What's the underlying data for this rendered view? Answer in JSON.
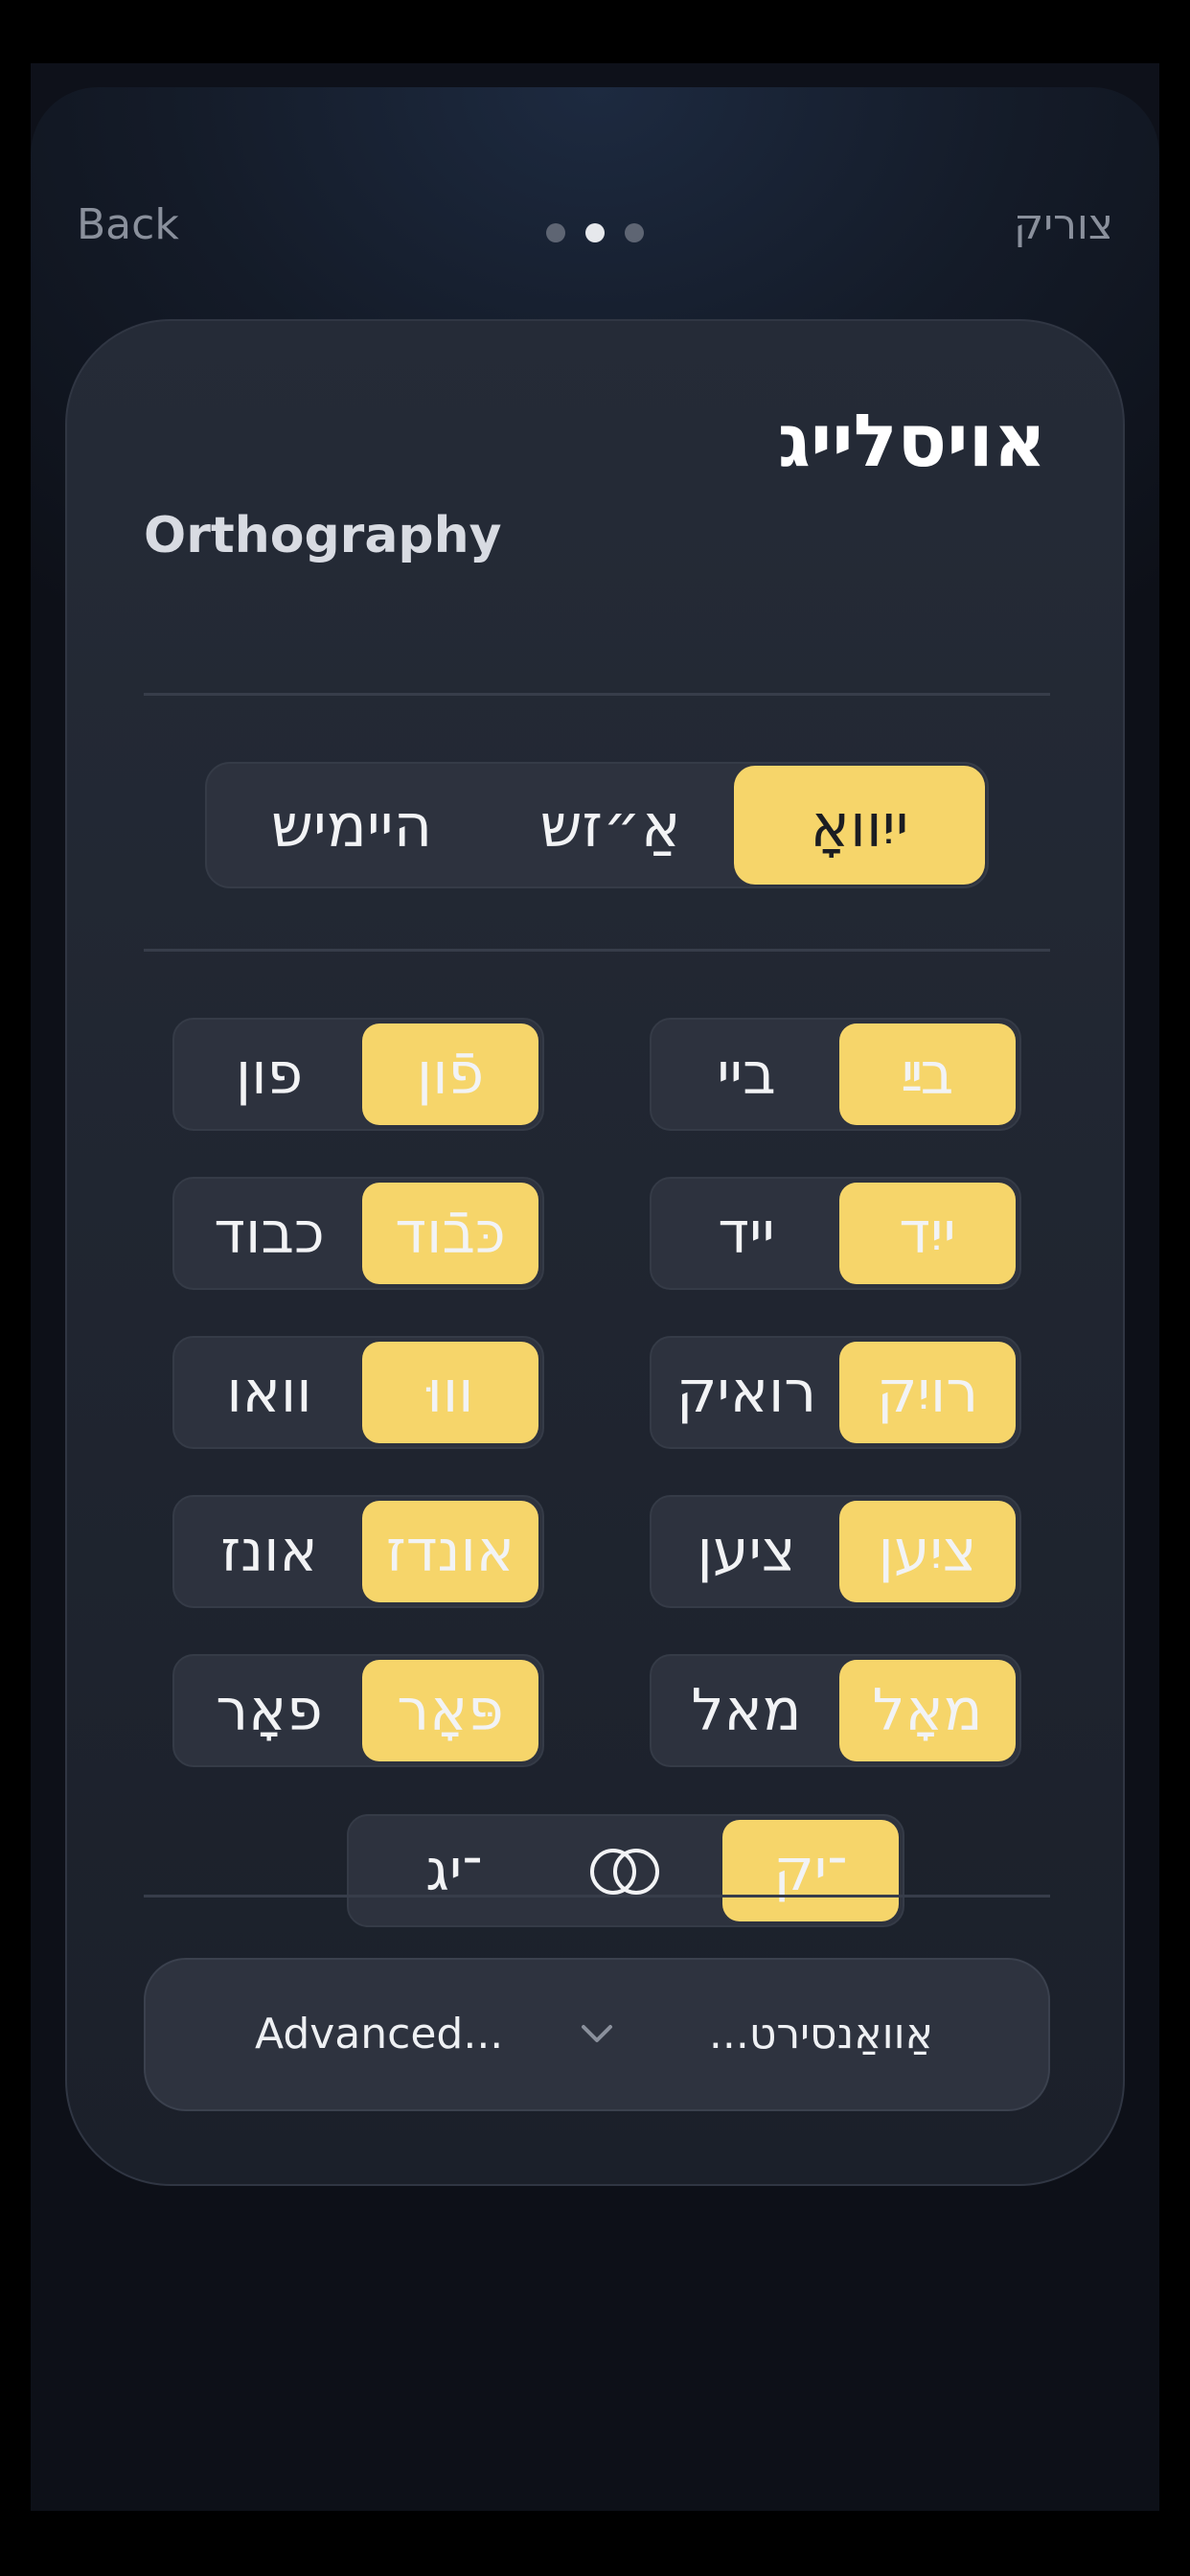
{
  "nav": {
    "back_label": "Back",
    "back_label_yiddish": "צוריק",
    "page_dots": 3,
    "active_page": 2
  },
  "card": {
    "title": "אויסלייג",
    "subtitle": "Orthography"
  },
  "system_selector": {
    "options": [
      "ייִוואָ",
      "אַ״זש",
      "היימיש"
    ],
    "selected": "ייִוואָ"
  },
  "pairs": [
    {
      "selected": "פֿון",
      "alternate": "פון"
    },
    {
      "selected": "בײַ",
      "alternate": "ביי"
    },
    {
      "selected": "כּבֿוד",
      "alternate": "כבוד"
    },
    {
      "selected": "ייִד",
      "alternate": "ייד"
    },
    {
      "selected": "וווּ",
      "alternate": "וואו"
    },
    {
      "selected": "רויִק",
      "alternate": "רואיק"
    },
    {
      "selected": "אונדז",
      "alternate": "אונז"
    },
    {
      "selected": "ציִען",
      "alternate": "ציען"
    },
    {
      "selected": "פּאָר",
      "alternate": "פאָר"
    },
    {
      "selected": "מאָל",
      "alternate": "מאל"
    }
  ],
  "ending": {
    "selected": "־יק",
    "alternate": "־יג",
    "link_icon": "linked-rings-icon"
  },
  "advanced": {
    "label": "Advanced...",
    "label_yiddish": "אַוואַנסירט...",
    "icon": "chevron-down-icon"
  },
  "colors": {
    "accent": "#f6d56a",
    "background": "#0e111a",
    "card": "#232834"
  }
}
